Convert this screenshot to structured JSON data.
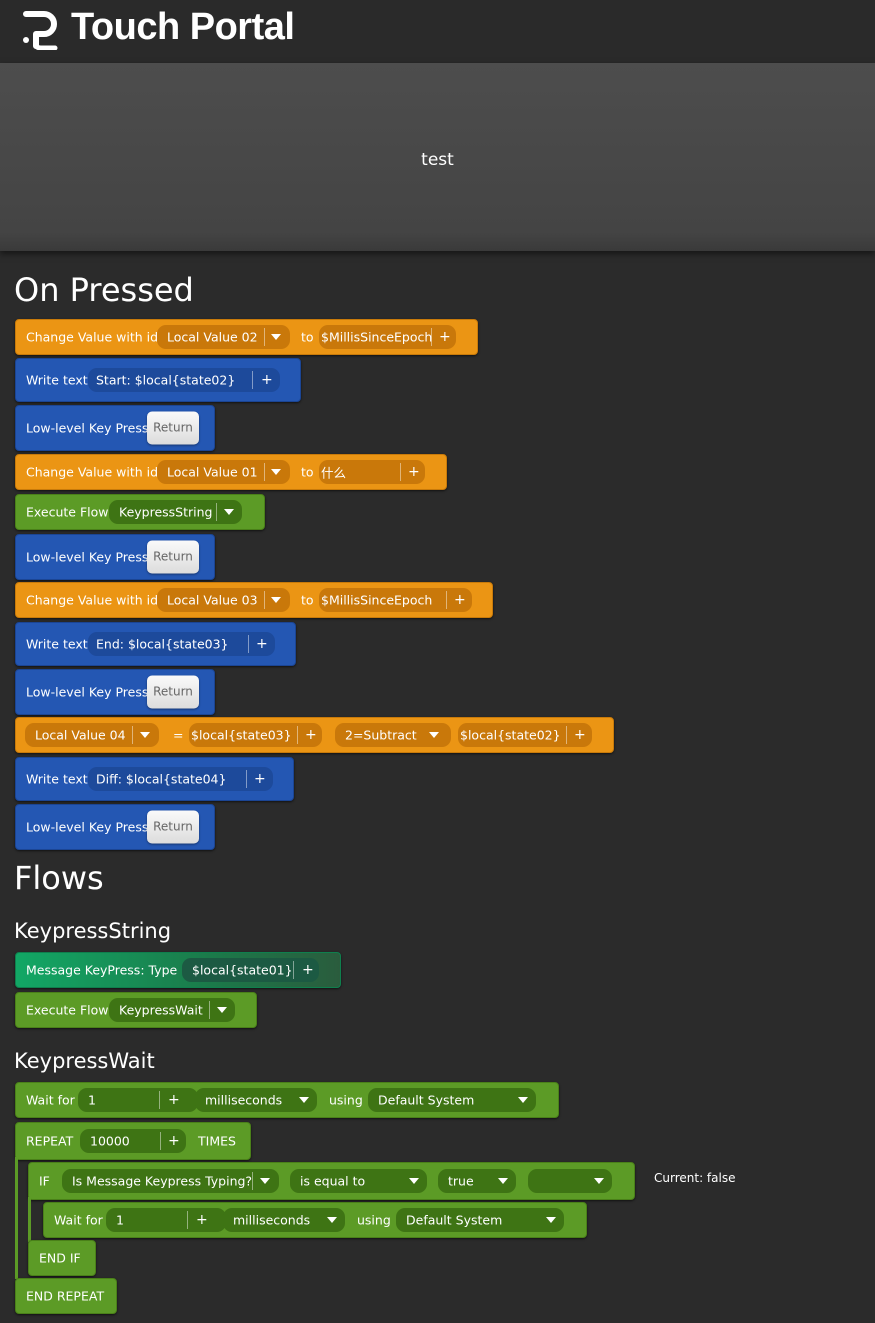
{
  "app": {
    "title": "Touch Portal"
  },
  "preview": {
    "text": "test"
  },
  "sections": {
    "on_pressed": "On Pressed",
    "flows": "Flows"
  },
  "flows": {
    "keypress_string": "KeypressString",
    "keypress_wait": "KeypressWait"
  },
  "actions": [
    {
      "label": "Change Value with id",
      "value": "Local Value 02",
      "to": "to",
      "expr": "$MillisSinceEpoch"
    },
    {
      "label": "Write text",
      "text": "Start: $local{state02}"
    },
    {
      "label": "Low-level Key Press",
      "key": "Return"
    },
    {
      "label": "Change Value with id",
      "value": "Local Value 01",
      "to": "to",
      "expr": "什么"
    },
    {
      "label": "Execute Flow",
      "flow": "KeypressString"
    },
    {
      "label": "Low-level Key Press",
      "key": "Return"
    },
    {
      "label": "Change Value with id",
      "value": "Local Value 03",
      "to": "to",
      "expr": "$MillisSinceEpoch"
    },
    {
      "label": "Write text",
      "text": "End: $local{state03}"
    },
    {
      "label": "Low-level Key Press",
      "key": "Return"
    },
    {
      "value": "Local Value 04",
      "eq": "=",
      "left": "$local{state03}",
      "op": "2=Subtract",
      "right": "$local{state02}"
    },
    {
      "label": "Write text",
      "text": "Diff: $local{state04}"
    },
    {
      "label": "Low-level Key Press",
      "key": "Return"
    }
  ],
  "flow_string": [
    {
      "label": "Message KeyPress: Type",
      "text": "$local{state01}"
    },
    {
      "label": "Execute Flow",
      "flow": "KeypressWait"
    }
  ],
  "flow_wait": {
    "wait1": {
      "label": "Wait for",
      "amount": "1",
      "unit": "milliseconds",
      "using": "using",
      "system": "Default System"
    },
    "repeat": {
      "label": "REPEAT",
      "count": "10000",
      "times": "TIMES"
    },
    "if": {
      "label": "IF",
      "condition": "Is Message Keypress Typing?",
      "compare": "is equal to",
      "value": "true",
      "extra": "",
      "current": "Current: false"
    },
    "wait2": {
      "label": "Wait for",
      "amount": "1",
      "unit": "milliseconds",
      "using": "using",
      "system": "Default System"
    },
    "endif": "END IF",
    "endrepeat": "END REPEAT"
  },
  "plus_symbol": "+",
  "colors": {
    "orange": "#eb9514",
    "blue": "#2457b3",
    "green": "#5c9b26",
    "teal": "#12a765",
    "background": "#2b2b2b"
  },
  "icons": [
    "touch-portal-logo-icon",
    "dropdown-caret-icon",
    "add-plus-icon"
  ]
}
